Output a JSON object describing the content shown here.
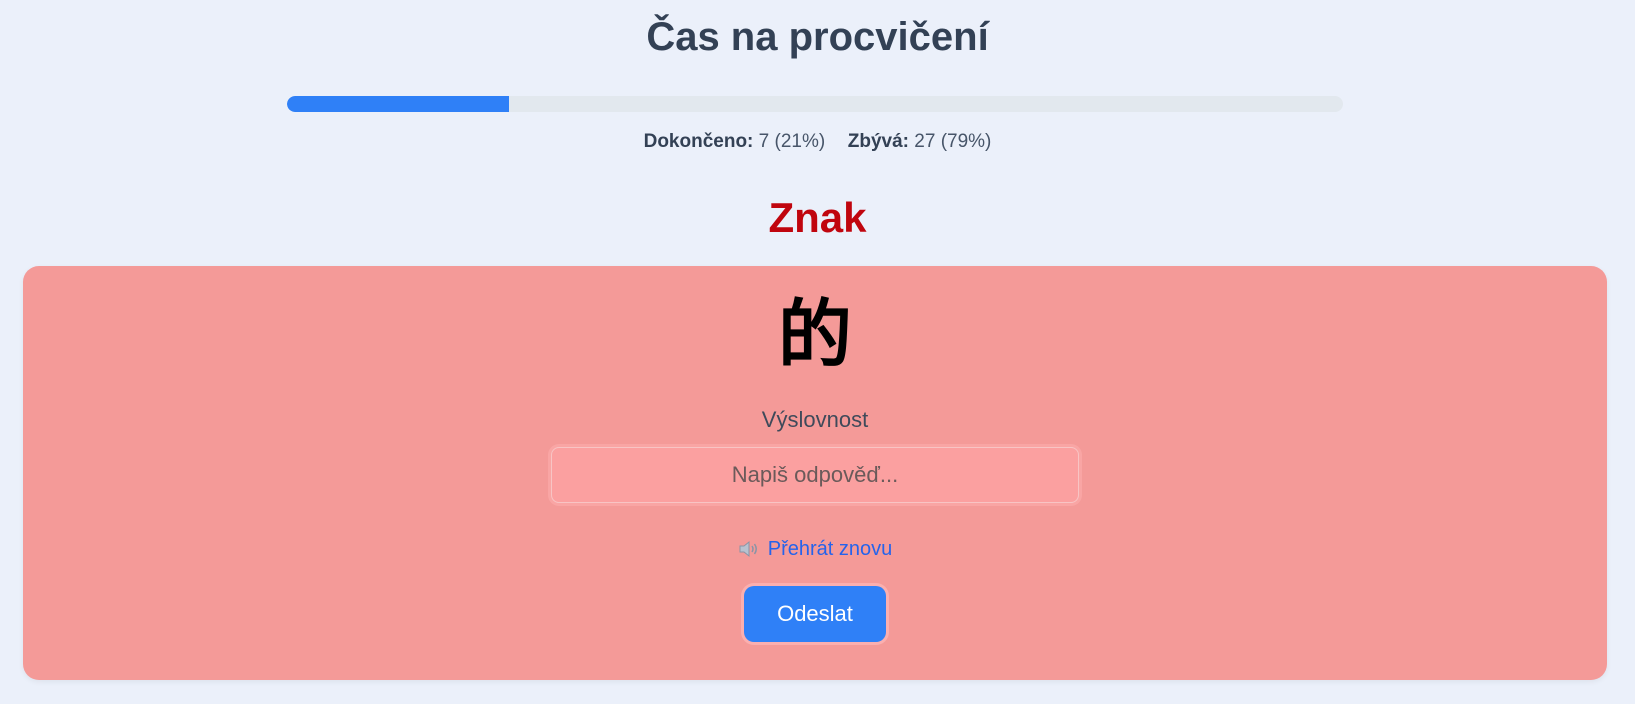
{
  "page": {
    "title": "Čas na procvičení"
  },
  "progress": {
    "fraction": 0.21,
    "done_label": "Dokončeno:",
    "done_value": "7 (21%)",
    "remaining_label": "Zbývá:",
    "remaining_value": "27 (79%)",
    "colors": {
      "fill": "#2f80f7",
      "track": "#e2e8ee"
    }
  },
  "quiz": {
    "section_heading": "Znak",
    "character": "的",
    "field_label": "Výslovnost",
    "input_value": "",
    "input_placeholder": "Napiš odpověď...",
    "replay_icon": "speaker-icon",
    "replay_label": "Přehrát znovu",
    "submit_label": "Odeslat",
    "colors": {
      "heading": "#c0050e",
      "card_background": "#f49a98",
      "button": "#2f80f7"
    }
  }
}
